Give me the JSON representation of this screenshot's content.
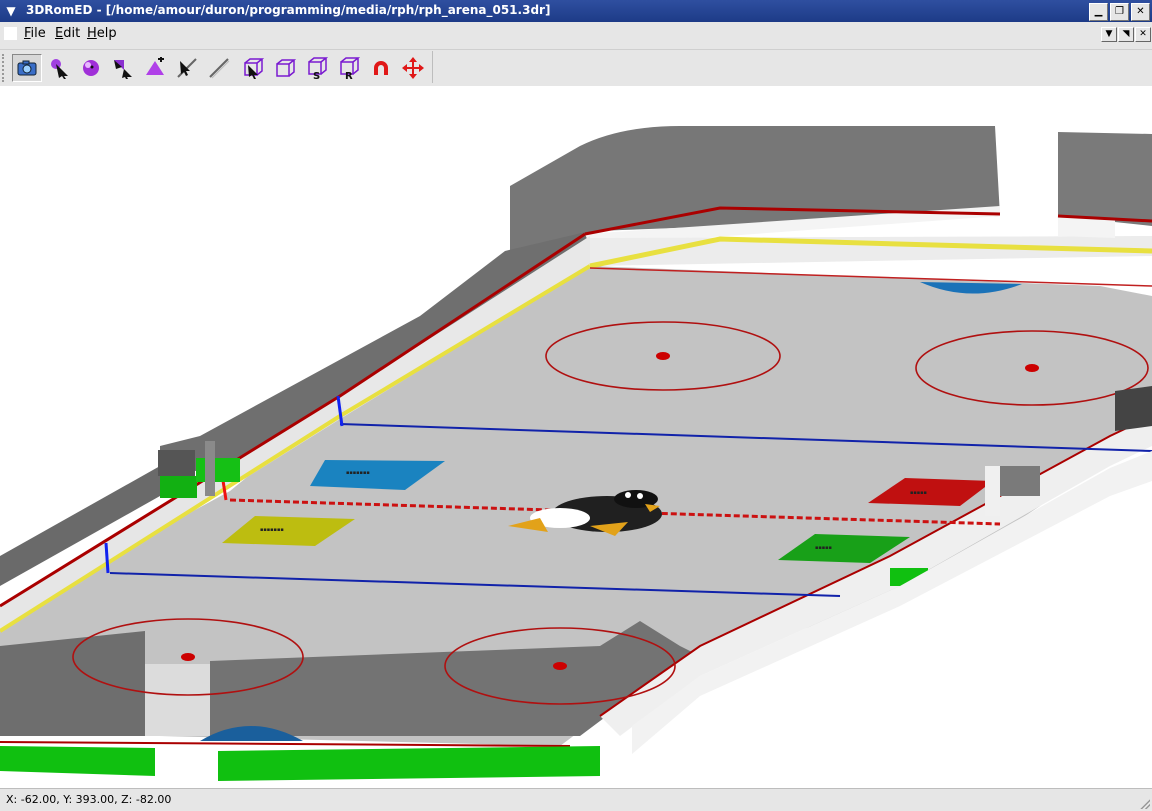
{
  "window": {
    "title": "3DRomED - [/home/amour/duron/programming/media/rph/rph_arena_051.3dr]",
    "controls": {
      "minimize": "▁",
      "maximize": "❐",
      "close": "✕"
    }
  },
  "menubar": {
    "items": [
      {
        "label": "File",
        "mnemonic": "F"
      },
      {
        "label": "Edit",
        "mnemonic": "E"
      },
      {
        "label": "Help",
        "mnemonic": "H"
      }
    ],
    "mdi_controls": {
      "minimize": "▼",
      "restore": "◥",
      "close": "✕"
    }
  },
  "toolbar": {
    "buttons": [
      {
        "icon": "camera-icon",
        "active": true
      },
      {
        "icon": "select-vertex-icon",
        "active": false
      },
      {
        "icon": "sphere-select-icon",
        "active": false
      },
      {
        "icon": "select-face-icon",
        "active": false
      },
      {
        "icon": "add-triangle-icon",
        "active": false
      },
      {
        "icon": "select-edge-icon",
        "active": false
      },
      {
        "icon": "line-icon",
        "active": false
      },
      {
        "icon": "select-box-icon",
        "active": false
      },
      {
        "icon": "move-box-icon",
        "active": false
      },
      {
        "icon": "scale-box-icon",
        "active": false,
        "letter": "S"
      },
      {
        "icon": "rotate-box-icon",
        "active": false,
        "letter": "R"
      },
      {
        "icon": "magnet-icon",
        "active": false
      },
      {
        "icon": "move-arrows-icon",
        "active": false
      }
    ]
  },
  "scene": {
    "description_colors": {
      "ice": "#c3c3c3",
      "wall": "#808080",
      "board": "#f4f4f4",
      "red_line": "#cc1111",
      "blue_line": "#1122aa",
      "yellow_trim": "#e8e040",
      "green_pad": "#11c011"
    }
  },
  "statusbar": {
    "coordinates": "X: -62.00, Y: 393.00, Z: -82.00"
  }
}
